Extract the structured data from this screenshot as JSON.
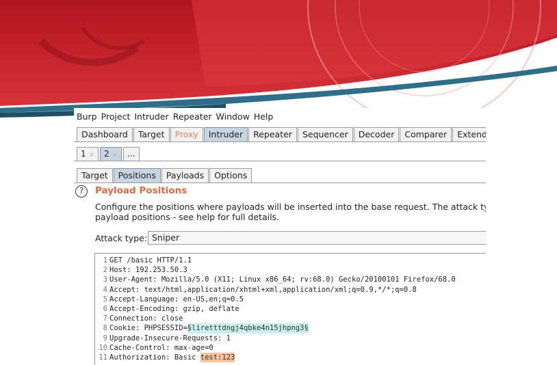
{
  "menu": [
    "Burp",
    "Project",
    "Intruder",
    "Repeater",
    "Window",
    "Help"
  ],
  "tabs": [
    "Dashboard",
    "Target",
    "Proxy",
    "Intruder",
    "Repeater",
    "Sequencer",
    "Decoder",
    "Comparer",
    "Extender"
  ],
  "attack_tabs": [
    {
      "label": "1",
      "close": "×"
    },
    {
      "label": "2",
      "close": "×"
    },
    {
      "label": "..."
    }
  ],
  "subtabs": [
    "Target",
    "Positions",
    "Payloads",
    "Options"
  ],
  "section": {
    "help_glyph": "?",
    "title": "Payload Positions",
    "desc_line1": "Configure the positions where payloads will be inserted into the base request. The attack type d",
    "desc_line2": "payload positions - see help for full details."
  },
  "attack_type": {
    "label": "Attack type:",
    "value": "Sniper"
  },
  "request": [
    {
      "n": "1",
      "pre": "GET /basic HTTP/1.1"
    },
    {
      "n": "2",
      "pre": "Host: 192.253.50.3"
    },
    {
      "n": "3",
      "pre": "User-Agent: Mozilla/5.0 (X11; Linux x86_64; rv:68.0) Gecko/20100101 Firefox/68.0"
    },
    {
      "n": "4",
      "pre": "Accept: text/html,application/xhtml+xml,application/xml;q=0.9,*/*;q=0.8"
    },
    {
      "n": "5",
      "pre": "Accept-Language: en-US,en;q=0.5"
    },
    {
      "n": "6",
      "pre": "Accept-Encoding: gzip, deflate"
    },
    {
      "n": "7",
      "pre": "Connection: close"
    },
    {
      "n": "8",
      "pre": "Cookie: PHPSESSID=",
      "mark": "§liretttdngj4qbke4n15jhpng3§"
    },
    {
      "n": "9",
      "pre": "Upgrade-Insecure-Requests: 1"
    },
    {
      "n": "10",
      "pre": "Cache-Control: max-age=0"
    },
    {
      "n": "11",
      "pre": "Authorization: Basic ",
      "mark2": "test:123"
    }
  ],
  "colors": {
    "accent_orange": "#e06a3b",
    "active_tab": "#c7d5e3",
    "marker_cyan": "#c9f0ec",
    "marker_orange": "#f7c39b",
    "banner_red": "#c8202b"
  }
}
